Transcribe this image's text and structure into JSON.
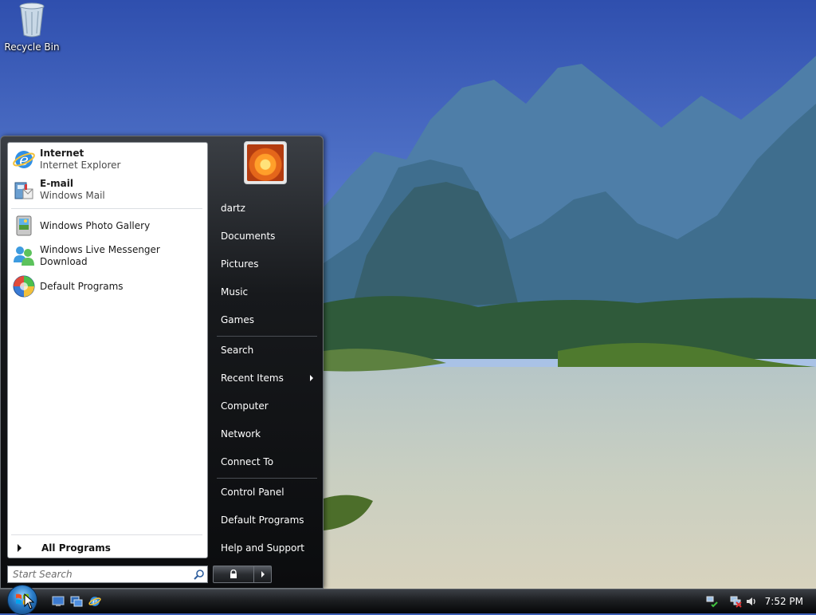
{
  "desktop": {
    "icons": [
      {
        "label": "Recycle Bin",
        "icon": "recycle-bin-icon"
      }
    ]
  },
  "start_menu": {
    "pinned": [
      {
        "title": "Internet",
        "subtitle": "Internet Explorer",
        "icon": "internet-explorer-icon"
      },
      {
        "title": "E-mail",
        "subtitle": "Windows Mail",
        "icon": "windows-mail-icon"
      }
    ],
    "recent": [
      {
        "label": "Windows Photo Gallery",
        "icon": "photo-gallery-icon"
      },
      {
        "label": "Windows Live Messenger Download",
        "icon": "messenger-icon"
      },
      {
        "label": "Default Programs",
        "icon": "default-programs-icon"
      }
    ],
    "all_programs": "All Programs",
    "search_placeholder": "Start Search",
    "right_items": {
      "user": "dartz",
      "documents": "Documents",
      "pictures": "Pictures",
      "music": "Music",
      "games": "Games",
      "search": "Search",
      "recent_items": "Recent Items",
      "computer": "Computer",
      "network": "Network",
      "connect_to": "Connect To",
      "control_panel": "Control Panel",
      "default_programs": "Default Programs",
      "help": "Help and Support"
    }
  },
  "taskbar": {
    "quick_launch": [
      "show-desktop-icon",
      "switch-windows-icon",
      "internet-explorer-icon"
    ],
    "tray_icons": [
      "network-connected-icon",
      "network-disconnected-icon",
      "volume-icon"
    ],
    "clock": "7:52 PM"
  },
  "colors": {
    "sky": "#3d5fb5",
    "menu_dark": "#0b0c0e",
    "taskbar": "#1d1f22"
  }
}
